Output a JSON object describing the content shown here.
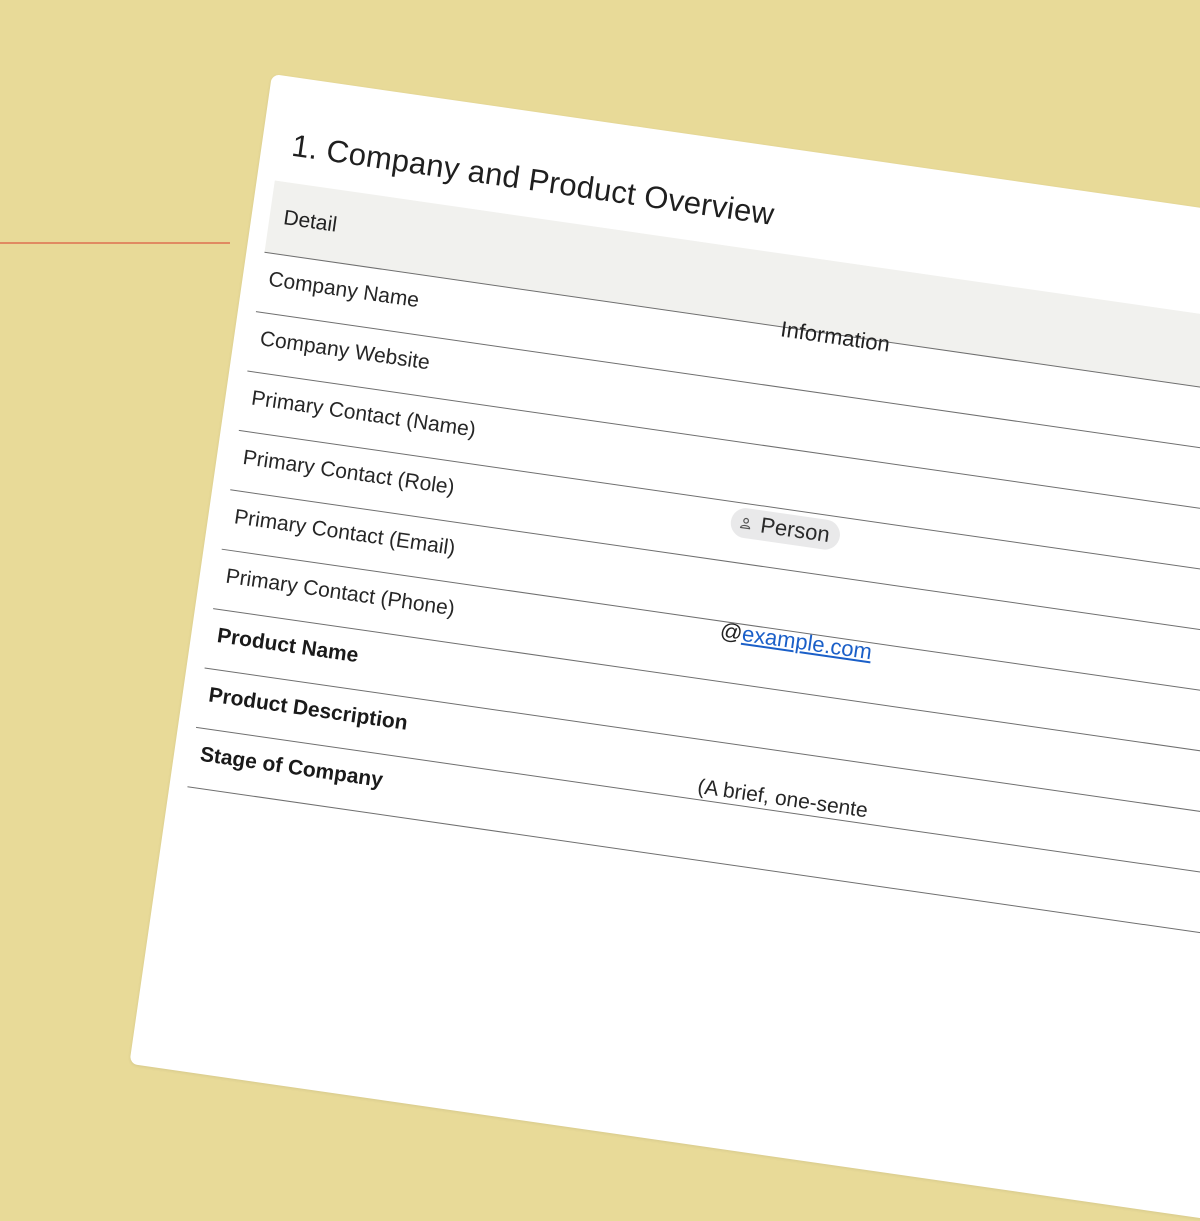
{
  "document": {
    "title": "1. Company and Product Overview",
    "table": {
      "headers": {
        "detail": "Detail",
        "information": "Information"
      },
      "rows": [
        {
          "label": "Company Name",
          "bold": false
        },
        {
          "label": "Company Website",
          "bold": false
        },
        {
          "label": "Primary Contact (Name)",
          "bold": false
        },
        {
          "label": "Primary Contact (Role)",
          "bold": false,
          "value_chip": {
            "icon": "person-icon",
            "text": "Person"
          }
        },
        {
          "label": "Primary Contact (Email)",
          "bold": false
        },
        {
          "label": "Primary Contact (Phone)",
          "bold": false,
          "value_prefix": "@",
          "value_link": "example.com"
        },
        {
          "label": "Product Name",
          "bold": true
        },
        {
          "label": "Product Description",
          "bold": true
        },
        {
          "label": "Stage of Company",
          "bold": true,
          "value_text": "(A brief, one-sente"
        }
      ]
    }
  },
  "colors": {
    "background": "#e8da98",
    "accent_line": "#e08a62",
    "header_fill": "#f1f1ee",
    "link": "#1a5fc8",
    "chip": "#e9e9ea"
  }
}
